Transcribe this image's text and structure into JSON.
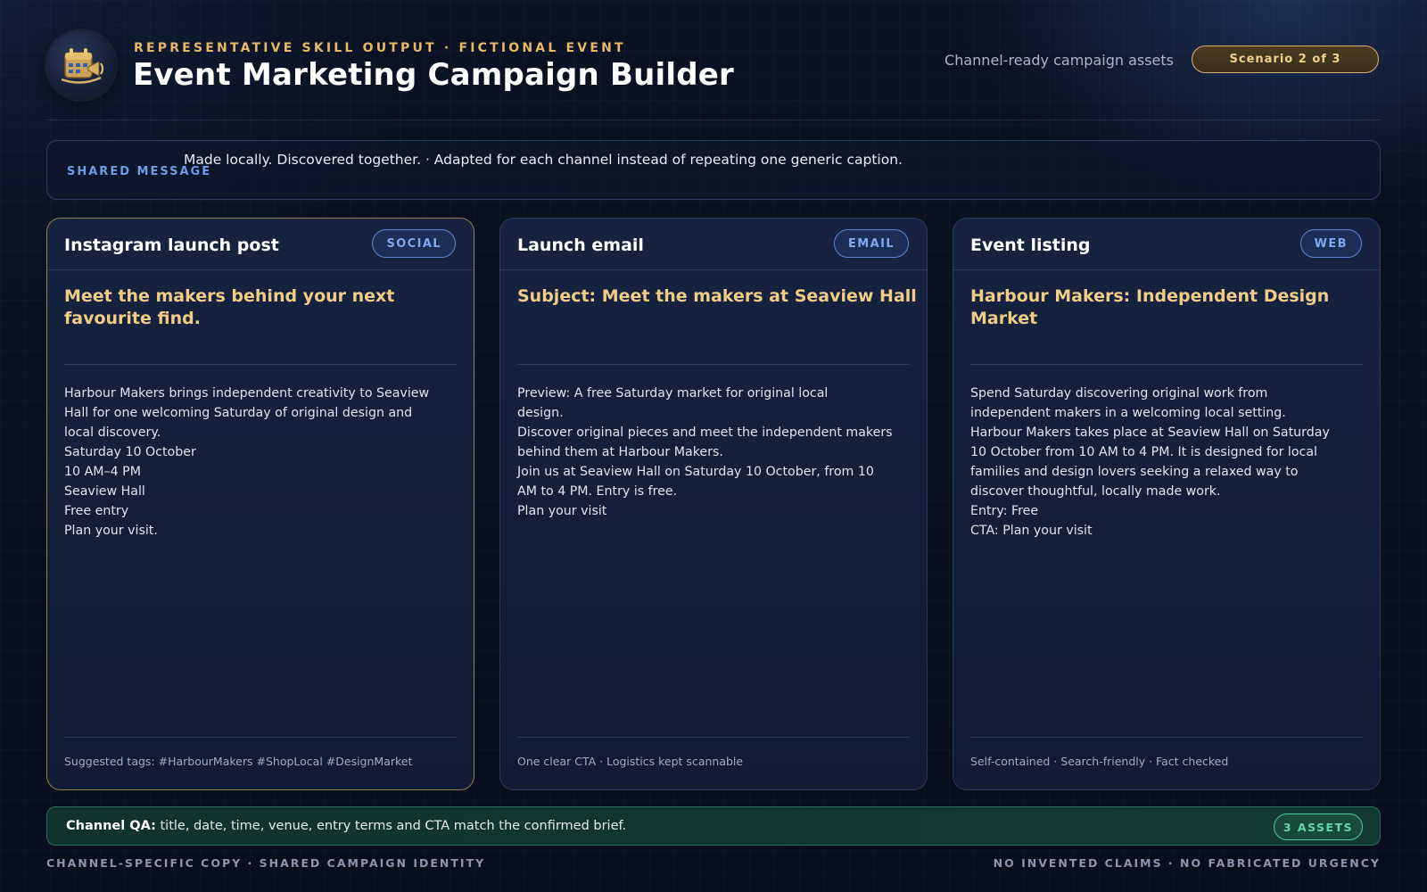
{
  "header": {
    "eyebrow": "REPRESENTATIVE SKILL OUTPUT · FICTIONAL EVENT",
    "title": "Event Marketing Campaign Builder",
    "tagline": "Channel-ready campaign assets",
    "scenario": "Scenario 2 of 3",
    "logo_icon": "calendar-megaphone-icon"
  },
  "shared": {
    "label": "SHARED MESSAGE",
    "text": "Made locally. Discovered together. · Adapted for each channel instead of repeating one generic caption."
  },
  "cards": [
    {
      "title": "Instagram launch post",
      "chip": "SOCIAL",
      "headline": "Meet the makers behind your next favourite find.",
      "lines": [
        "Harbour Makers brings independent creativity to Seaview",
        "Hall for one welcoming Saturday of original design and",
        "local discovery.",
        "Saturday 10 October",
        "10 AM–4 PM",
        "Seaview Hall",
        "Free entry",
        "Plan your visit."
      ],
      "footnote": "Suggested tags: #HarbourMakers #ShopLocal #DesignMarket"
    },
    {
      "title": "Launch email",
      "chip": "EMAIL",
      "headline": "Subject: Meet the makers at Seaview Hall",
      "lines": [
        "Preview: A free Saturday market for original local",
        "design.",
        "Discover original pieces and meet the independent makers",
        "behind them at Harbour Makers.",
        "Join us at Seaview Hall on Saturday 10 October, from 10",
        "AM to 4 PM. Entry is free.",
        "Plan your visit"
      ],
      "footnote": "One clear CTA · Logistics kept scannable"
    },
    {
      "title": "Event listing",
      "chip": "WEB",
      "headline": "Harbour Makers: Independent Design Market",
      "lines": [
        "Spend Saturday discovering original work from",
        "independent makers in a welcoming local setting.",
        "Harbour Makers takes place at Seaview Hall on Saturday",
        "10 October from 10 AM to 4 PM. It is designed for local",
        "families and design lovers seeking a relaxed way to",
        "discover thoughtful, locally made work.",
        "Entry: Free",
        "CTA: Plan your visit"
      ],
      "footnote": "Self-contained · Search-friendly · Fact checked"
    }
  ],
  "qa": {
    "label": "Channel QA:",
    "text": " title, date, time, venue, entry terms and CTA match the confirmed brief.",
    "chip": "3 ASSETS"
  },
  "footer": {
    "left": "CHANNEL-SPECIFIC COPY · SHARED CAMPAIGN IDENTITY",
    "right": "NO INVENTED CLAIMS · NO FABRICATED URGENCY"
  },
  "colors": {
    "accent_gold": "#f0cd86",
    "accent_blue": "#6f9ce8",
    "qa_green": "#4fc79a"
  }
}
